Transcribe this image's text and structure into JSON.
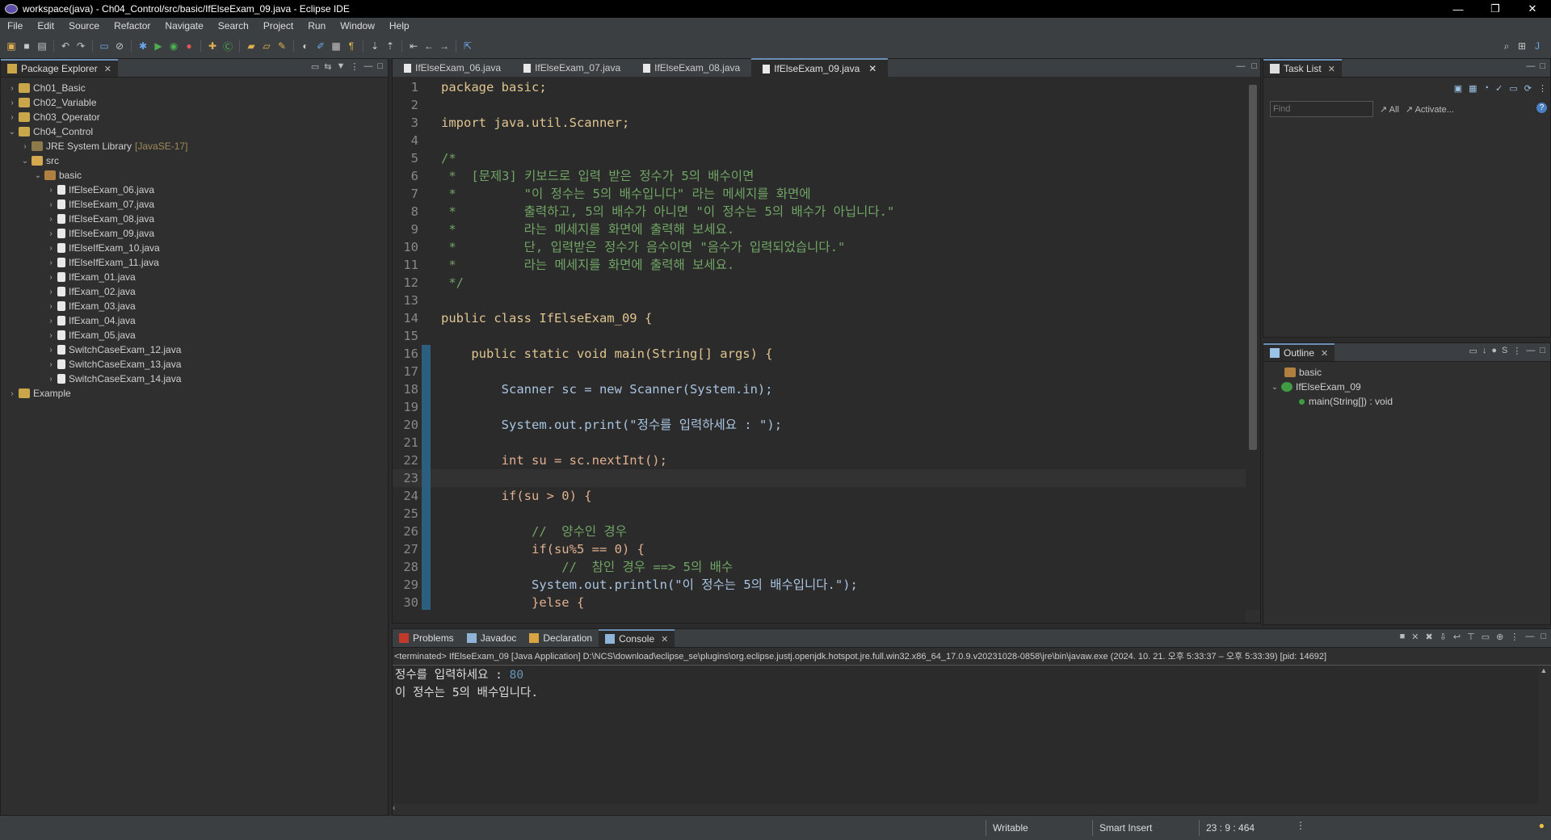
{
  "window": {
    "title": "workspace(java) - Ch04_Control/src/basic/IfElseExam_09.java - Eclipse IDE",
    "minimize": "—",
    "restore": "❐",
    "close": "✕"
  },
  "menu": [
    "File",
    "Edit",
    "Source",
    "Refactor",
    "Navigate",
    "Search",
    "Project",
    "Run",
    "Window",
    "Help"
  ],
  "package_explorer": {
    "tab_label": "Package Explorer",
    "items": [
      {
        "label": "Ch01_Basic",
        "chev": "›",
        "icon": "project-icon",
        "extra": ""
      },
      {
        "label": "Ch02_Variable",
        "chev": "›",
        "icon": "project-icon",
        "extra": ""
      },
      {
        "label": "Ch03_Operator",
        "chev": "›",
        "icon": "project-icon",
        "extra": ""
      },
      {
        "label": "Ch04_Control",
        "chev": "⌄",
        "icon": "project-icon",
        "extra": ""
      },
      {
        "label": "JRE System Library",
        "chev": "›",
        "icon": "library-icon",
        "extra": "[JavaSE-17]"
      },
      {
        "label": "src",
        "chev": "⌄",
        "icon": "source-folder-icon",
        "extra": ""
      },
      {
        "label": "basic",
        "chev": "⌄",
        "icon": "package-icon",
        "extra": ""
      },
      {
        "label": "IfElseExam_06.java",
        "chev": "›",
        "icon": "java-file-icon",
        "extra": ""
      },
      {
        "label": "IfElseExam_07.java",
        "chev": "›",
        "icon": "java-file-icon",
        "extra": ""
      },
      {
        "label": "IfElseExam_08.java",
        "chev": "›",
        "icon": "java-file-icon",
        "extra": ""
      },
      {
        "label": "IfElseExam_09.java",
        "chev": "›",
        "icon": "java-file-icon",
        "extra": ""
      },
      {
        "label": "IfElseIfExam_10.java",
        "chev": "›",
        "icon": "java-file-icon",
        "extra": ""
      },
      {
        "label": "IfElseIfExam_11.java",
        "chev": "›",
        "icon": "java-file-icon",
        "extra": ""
      },
      {
        "label": "IfExam_01.java",
        "chev": "›",
        "icon": "java-file-icon",
        "extra": ""
      },
      {
        "label": "IfExam_02.java",
        "chev": "›",
        "icon": "java-file-icon",
        "extra": ""
      },
      {
        "label": "IfExam_03.java",
        "chev": "›",
        "icon": "java-file-icon",
        "extra": ""
      },
      {
        "label": "IfExam_04.java",
        "chev": "›",
        "icon": "java-file-icon",
        "extra": ""
      },
      {
        "label": "IfExam_05.java",
        "chev": "›",
        "icon": "java-file-icon",
        "extra": ""
      },
      {
        "label": "SwitchCaseExam_12.java",
        "chev": "›",
        "icon": "java-file-icon",
        "extra": ""
      },
      {
        "label": "SwitchCaseExam_13.java",
        "chev": "›",
        "icon": "java-file-icon",
        "extra": ""
      },
      {
        "label": "SwitchCaseExam_14.java",
        "chev": "›",
        "icon": "java-file-icon",
        "extra": ""
      },
      {
        "label": "Example",
        "chev": "›",
        "icon": "project-icon",
        "extra": ""
      }
    ]
  },
  "editor_tabs": [
    {
      "label": "IfElseExam_06.java",
      "active": false
    },
    {
      "label": "IfElseExam_07.java",
      "active": false
    },
    {
      "label": "IfElseExam_08.java",
      "active": false
    },
    {
      "label": "IfElseExam_09.java",
      "active": true
    }
  ],
  "code_lines": [
    {
      "n": "1",
      "t": "package basic;"
    },
    {
      "n": "2",
      "t": ""
    },
    {
      "n": "3",
      "t": "import java.util.Scanner;"
    },
    {
      "n": "4",
      "t": ""
    },
    {
      "n": "5",
      "t": "/*"
    },
    {
      "n": "6",
      "t": " *  [문제3] 키보드로 입력 받은 정수가 5의 배수이면"
    },
    {
      "n": "7",
      "t": " *         \"이 정수는 5의 배수입니다\" 라는 메세지를 화면에"
    },
    {
      "n": "8",
      "t": " *         출력하고, 5의 배수가 아니면 \"이 정수는 5의 배수가 아닙니다.\""
    },
    {
      "n": "9",
      "t": " *         라는 메세지를 화면에 출력해 보세요."
    },
    {
      "n": "10",
      "t": " *         단, 입력받은 정수가 음수이면 \"음수가 입력되었습니다.\""
    },
    {
      "n": "11",
      "t": " *         라는 메세지를 화면에 출력해 보세요."
    },
    {
      "n": "12",
      "t": " */"
    },
    {
      "n": "13",
      "t": ""
    },
    {
      "n": "14",
      "t": "public class IfElseExam_09 {"
    },
    {
      "n": "15",
      "t": ""
    },
    {
      "n": "16",
      "t": "    public static void main(String[] args) {"
    },
    {
      "n": "17",
      "t": ""
    },
    {
      "n": "18",
      "t": "        Scanner sc = new Scanner(System.in);"
    },
    {
      "n": "19",
      "t": ""
    },
    {
      "n": "20",
      "t": "        System.out.print(\"정수를 입력하세요 : \");"
    },
    {
      "n": "21",
      "t": ""
    },
    {
      "n": "22",
      "t": "        int su = sc.nextInt();"
    },
    {
      "n": "23",
      "t": "        "
    },
    {
      "n": "24",
      "t": "        if(su > 0) {"
    },
    {
      "n": "25",
      "t": ""
    },
    {
      "n": "26",
      "t": "            //  양수인 경우"
    },
    {
      "n": "27",
      "t": "            if(su%5 == 0) {"
    },
    {
      "n": "28",
      "t": "                //  참인 경우 ==> 5의 배수"
    },
    {
      "n": "29",
      "t": "            System.out.println(\"이 정수는 5의 배수입니다.\");"
    },
    {
      "n": "30",
      "t": "            }else {"
    }
  ],
  "task_list": {
    "tab_label": "Task List",
    "find_placeholder": "Find",
    "all_label": "All",
    "activate_label": "Activate..."
  },
  "outline": {
    "tab_label": "Outline",
    "package": "basic",
    "class": "IfElseExam_09",
    "method": "main(String[]) : void"
  },
  "bottom_tabs": [
    {
      "label": "Problems",
      "active": false
    },
    {
      "label": "Javadoc",
      "active": false
    },
    {
      "label": "Declaration",
      "active": false
    },
    {
      "label": "Console",
      "active": true
    }
  ],
  "console": {
    "terminated": "<terminated> IfElseExam_09 [Java Application] D:\\NCS\\download\\eclipse_se\\plugins\\org.eclipse.justj.openjdk.hotspot.jre.full.win32.x86_64_17.0.9.v20231028-0858\\jre\\bin\\javaw.exe  (2024. 10. 21. 오후 5:33:37 – 오후 5:33:39) [pid: 14692]",
    "prompt": "정수를 입력하세요 : ",
    "input": "80",
    "output": "이 정수는 5의 배수입니다."
  },
  "status": {
    "writable": "Writable",
    "insert_mode": "Smart Insert",
    "position": "23 : 9 : 464"
  },
  "colors": {
    "background": "#2b2b2b",
    "panel": "#3c3f41",
    "keyword": "#cc7832",
    "comment": "#71a565",
    "string": "#e6e39c",
    "type": "#6897bb"
  }
}
